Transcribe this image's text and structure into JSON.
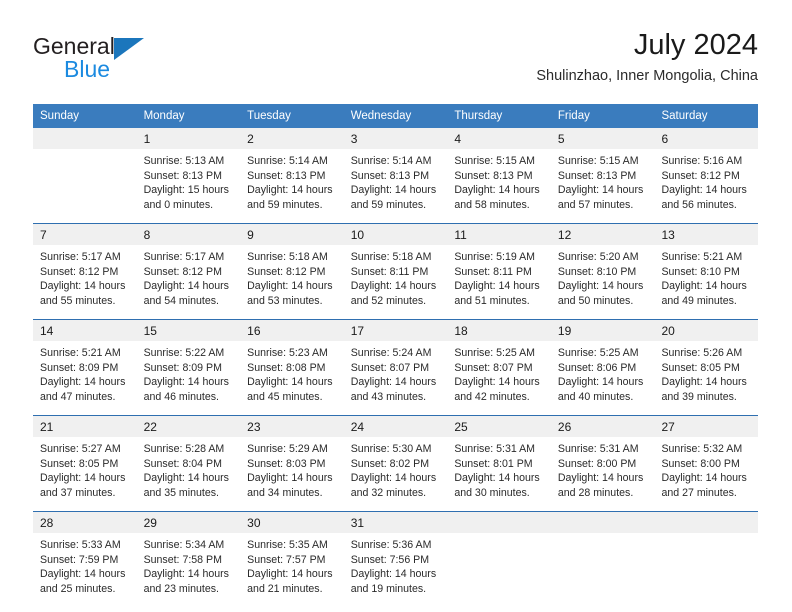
{
  "brand": {
    "name_part1": "General",
    "name_part2": "Blue",
    "logo_icon": "triangle-flag-icon"
  },
  "header": {
    "title": "July 2024",
    "subtitle": "Shulinzhao, Inner Mongolia, China"
  },
  "calendar": {
    "weekdays": [
      "Sunday",
      "Monday",
      "Tuesday",
      "Wednesday",
      "Thursday",
      "Friday",
      "Saturday"
    ],
    "accent_color": "#3a7cbe",
    "separator_color": "#2f6fb0",
    "number_band_color": "#f0f0f0",
    "labels": {
      "sunrise": "Sunrise:",
      "sunset": "Sunset:",
      "daylight": "Daylight:"
    },
    "weeks": [
      {
        "days": [
          {
            "num": "",
            "sunrise": "",
            "sunset": "",
            "daylight_line1": "",
            "daylight_line2": ""
          },
          {
            "num": "1",
            "sunrise": "Sunrise: 5:13 AM",
            "sunset": "Sunset: 8:13 PM",
            "daylight_line1": "Daylight: 15 hours",
            "daylight_line2": "and 0 minutes."
          },
          {
            "num": "2",
            "sunrise": "Sunrise: 5:14 AM",
            "sunset": "Sunset: 8:13 PM",
            "daylight_line1": "Daylight: 14 hours",
            "daylight_line2": "and 59 minutes."
          },
          {
            "num": "3",
            "sunrise": "Sunrise: 5:14 AM",
            "sunset": "Sunset: 8:13 PM",
            "daylight_line1": "Daylight: 14 hours",
            "daylight_line2": "and 59 minutes."
          },
          {
            "num": "4",
            "sunrise": "Sunrise: 5:15 AM",
            "sunset": "Sunset: 8:13 PM",
            "daylight_line1": "Daylight: 14 hours",
            "daylight_line2": "and 58 minutes."
          },
          {
            "num": "5",
            "sunrise": "Sunrise: 5:15 AM",
            "sunset": "Sunset: 8:13 PM",
            "daylight_line1": "Daylight: 14 hours",
            "daylight_line2": "and 57 minutes."
          },
          {
            "num": "6",
            "sunrise": "Sunrise: 5:16 AM",
            "sunset": "Sunset: 8:12 PM",
            "daylight_line1": "Daylight: 14 hours",
            "daylight_line2": "and 56 minutes."
          }
        ]
      },
      {
        "days": [
          {
            "num": "7",
            "sunrise": "Sunrise: 5:17 AM",
            "sunset": "Sunset: 8:12 PM",
            "daylight_line1": "Daylight: 14 hours",
            "daylight_line2": "and 55 minutes."
          },
          {
            "num": "8",
            "sunrise": "Sunrise: 5:17 AM",
            "sunset": "Sunset: 8:12 PM",
            "daylight_line1": "Daylight: 14 hours",
            "daylight_line2": "and 54 minutes."
          },
          {
            "num": "9",
            "sunrise": "Sunrise: 5:18 AM",
            "sunset": "Sunset: 8:12 PM",
            "daylight_line1": "Daylight: 14 hours",
            "daylight_line2": "and 53 minutes."
          },
          {
            "num": "10",
            "sunrise": "Sunrise: 5:18 AM",
            "sunset": "Sunset: 8:11 PM",
            "daylight_line1": "Daylight: 14 hours",
            "daylight_line2": "and 52 minutes."
          },
          {
            "num": "11",
            "sunrise": "Sunrise: 5:19 AM",
            "sunset": "Sunset: 8:11 PM",
            "daylight_line1": "Daylight: 14 hours",
            "daylight_line2": "and 51 minutes."
          },
          {
            "num": "12",
            "sunrise": "Sunrise: 5:20 AM",
            "sunset": "Sunset: 8:10 PM",
            "daylight_line1": "Daylight: 14 hours",
            "daylight_line2": "and 50 minutes."
          },
          {
            "num": "13",
            "sunrise": "Sunrise: 5:21 AM",
            "sunset": "Sunset: 8:10 PM",
            "daylight_line1": "Daylight: 14 hours",
            "daylight_line2": "and 49 minutes."
          }
        ]
      },
      {
        "days": [
          {
            "num": "14",
            "sunrise": "Sunrise: 5:21 AM",
            "sunset": "Sunset: 8:09 PM",
            "daylight_line1": "Daylight: 14 hours",
            "daylight_line2": "and 47 minutes."
          },
          {
            "num": "15",
            "sunrise": "Sunrise: 5:22 AM",
            "sunset": "Sunset: 8:09 PM",
            "daylight_line1": "Daylight: 14 hours",
            "daylight_line2": "and 46 minutes."
          },
          {
            "num": "16",
            "sunrise": "Sunrise: 5:23 AM",
            "sunset": "Sunset: 8:08 PM",
            "daylight_line1": "Daylight: 14 hours",
            "daylight_line2": "and 45 minutes."
          },
          {
            "num": "17",
            "sunrise": "Sunrise: 5:24 AM",
            "sunset": "Sunset: 8:07 PM",
            "daylight_line1": "Daylight: 14 hours",
            "daylight_line2": "and 43 minutes."
          },
          {
            "num": "18",
            "sunrise": "Sunrise: 5:25 AM",
            "sunset": "Sunset: 8:07 PM",
            "daylight_line1": "Daylight: 14 hours",
            "daylight_line2": "and 42 minutes."
          },
          {
            "num": "19",
            "sunrise": "Sunrise: 5:25 AM",
            "sunset": "Sunset: 8:06 PM",
            "daylight_line1": "Daylight: 14 hours",
            "daylight_line2": "and 40 minutes."
          },
          {
            "num": "20",
            "sunrise": "Sunrise: 5:26 AM",
            "sunset": "Sunset: 8:05 PM",
            "daylight_line1": "Daylight: 14 hours",
            "daylight_line2": "and 39 minutes."
          }
        ]
      },
      {
        "days": [
          {
            "num": "21",
            "sunrise": "Sunrise: 5:27 AM",
            "sunset": "Sunset: 8:05 PM",
            "daylight_line1": "Daylight: 14 hours",
            "daylight_line2": "and 37 minutes."
          },
          {
            "num": "22",
            "sunrise": "Sunrise: 5:28 AM",
            "sunset": "Sunset: 8:04 PM",
            "daylight_line1": "Daylight: 14 hours",
            "daylight_line2": "and 35 minutes."
          },
          {
            "num": "23",
            "sunrise": "Sunrise: 5:29 AM",
            "sunset": "Sunset: 8:03 PM",
            "daylight_line1": "Daylight: 14 hours",
            "daylight_line2": "and 34 minutes."
          },
          {
            "num": "24",
            "sunrise": "Sunrise: 5:30 AM",
            "sunset": "Sunset: 8:02 PM",
            "daylight_line1": "Daylight: 14 hours",
            "daylight_line2": "and 32 minutes."
          },
          {
            "num": "25",
            "sunrise": "Sunrise: 5:31 AM",
            "sunset": "Sunset: 8:01 PM",
            "daylight_line1": "Daylight: 14 hours",
            "daylight_line2": "and 30 minutes."
          },
          {
            "num": "26",
            "sunrise": "Sunrise: 5:31 AM",
            "sunset": "Sunset: 8:00 PM",
            "daylight_line1": "Daylight: 14 hours",
            "daylight_line2": "and 28 minutes."
          },
          {
            "num": "27",
            "sunrise": "Sunrise: 5:32 AM",
            "sunset": "Sunset: 8:00 PM",
            "daylight_line1": "Daylight: 14 hours",
            "daylight_line2": "and 27 minutes."
          }
        ]
      },
      {
        "days": [
          {
            "num": "28",
            "sunrise": "Sunrise: 5:33 AM",
            "sunset": "Sunset: 7:59 PM",
            "daylight_line1": "Daylight: 14 hours",
            "daylight_line2": "and 25 minutes."
          },
          {
            "num": "29",
            "sunrise": "Sunrise: 5:34 AM",
            "sunset": "Sunset: 7:58 PM",
            "daylight_line1": "Daylight: 14 hours",
            "daylight_line2": "and 23 minutes."
          },
          {
            "num": "30",
            "sunrise": "Sunrise: 5:35 AM",
            "sunset": "Sunset: 7:57 PM",
            "daylight_line1": "Daylight: 14 hours",
            "daylight_line2": "and 21 minutes."
          },
          {
            "num": "31",
            "sunrise": "Sunrise: 5:36 AM",
            "sunset": "Sunset: 7:56 PM",
            "daylight_line1": "Daylight: 14 hours",
            "daylight_line2": "and 19 minutes."
          },
          {
            "num": "",
            "sunrise": "",
            "sunset": "",
            "daylight_line1": "",
            "daylight_line2": ""
          },
          {
            "num": "",
            "sunrise": "",
            "sunset": "",
            "daylight_line1": "",
            "daylight_line2": ""
          },
          {
            "num": "",
            "sunrise": "",
            "sunset": "",
            "daylight_line1": "",
            "daylight_line2": ""
          }
        ]
      }
    ]
  }
}
